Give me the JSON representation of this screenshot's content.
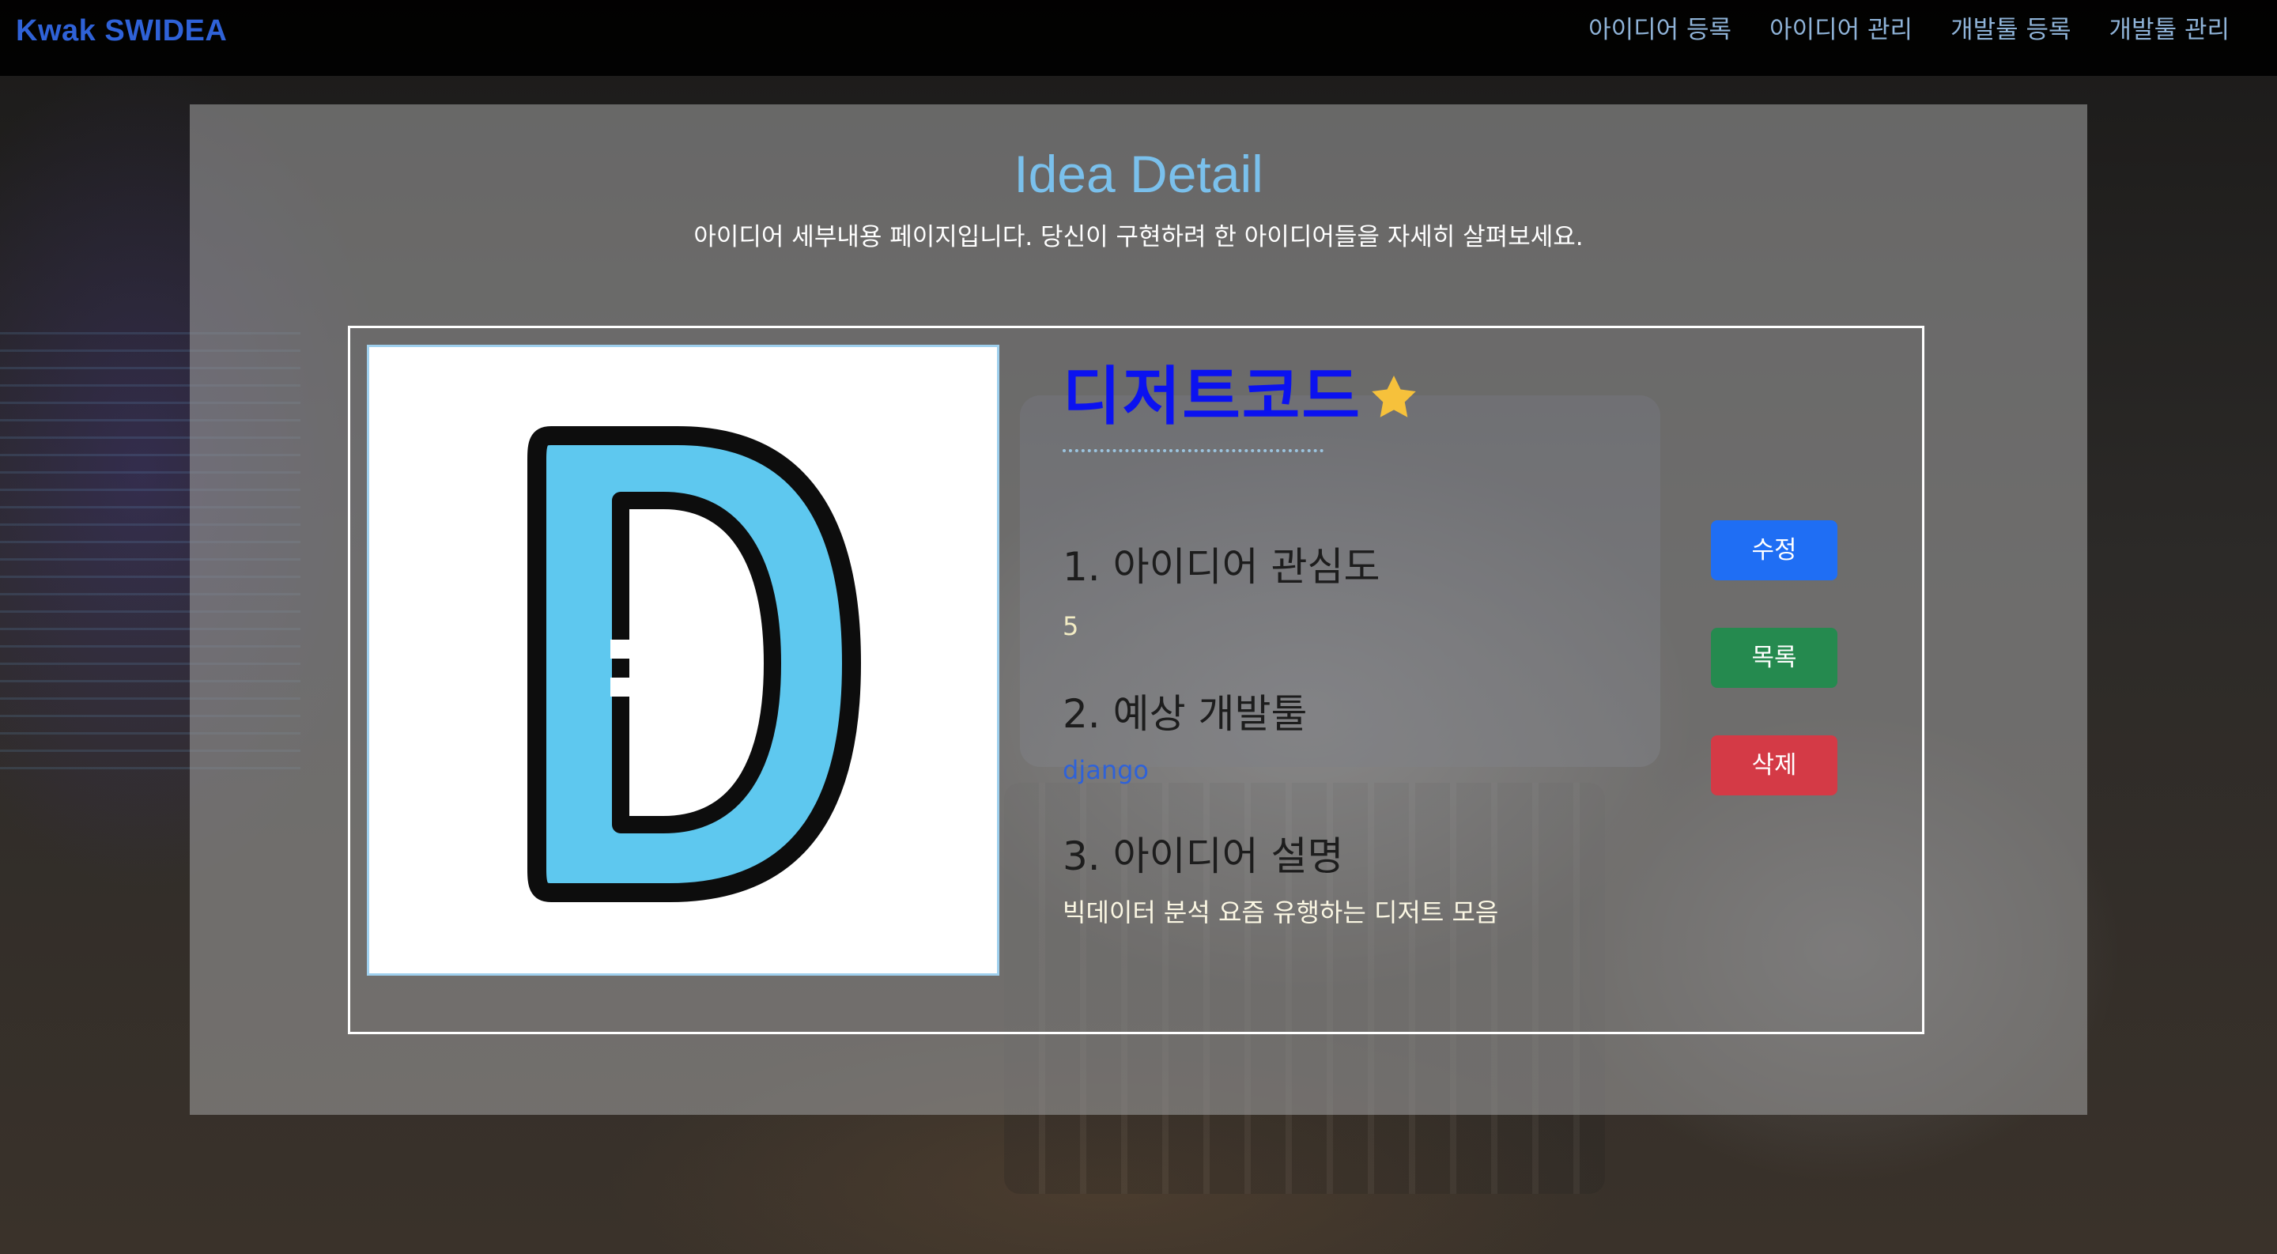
{
  "navbar": {
    "brand": "Kwak SWIDEA",
    "links": [
      {
        "label": "아이디어 등록"
      },
      {
        "label": "아이디어 관리"
      },
      {
        "label": "개발툴 등록"
      },
      {
        "label": "개발툴 관리"
      }
    ]
  },
  "page": {
    "title": "Idea Detail",
    "subtitle": "아이디어 세부내용 페이지입니다. 당신이 구현하려 한 아이디어들을 자세히 살펴보세요."
  },
  "idea": {
    "name": "디저트코드",
    "starred": true,
    "star_color": "#f6c13b",
    "image_icon": "letter-d-icon",
    "image_letter_color": "#5ec8ef",
    "sections": [
      {
        "heading": "1. 아이디어 관심도",
        "value": "5"
      },
      {
        "heading": "2. 예상 개발툴",
        "value": "django"
      },
      {
        "heading": "3. 아이디어 설명",
        "value": "빅데이터 분석 요즘 유행하는 디저트 모음"
      }
    ]
  },
  "actions": {
    "edit_label": "수정",
    "list_label": "목록",
    "delete_label": "삭제"
  },
  "colors": {
    "brand": "#2f62d8",
    "title": "#7ac0ec",
    "idea_name": "#0b12f0",
    "edit": "#1f6ef4",
    "list": "#258a4f",
    "delete": "#d43a46"
  }
}
